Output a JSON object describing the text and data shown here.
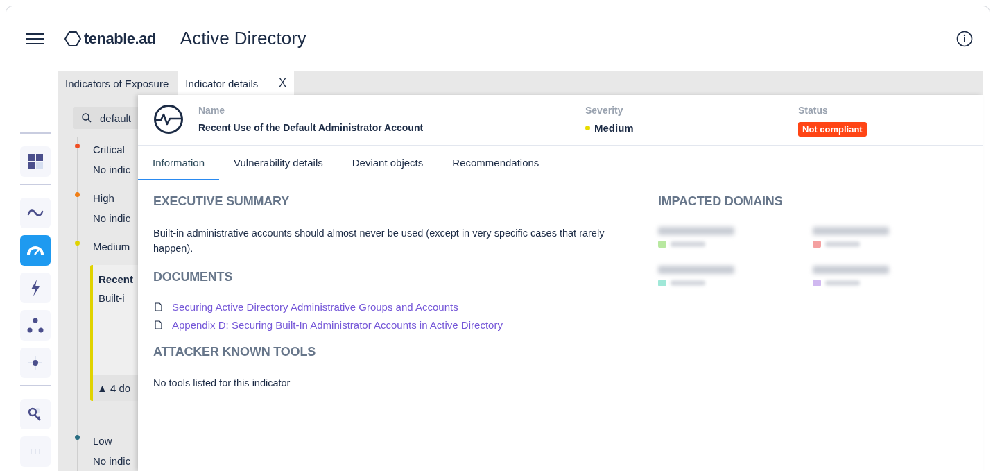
{
  "header": {
    "logo": "tenable.ad",
    "title": "Active Directory"
  },
  "rail": [
    {
      "kind": "divider"
    },
    {
      "kind": "dashboard",
      "selected": false
    },
    {
      "kind": "divider"
    },
    {
      "kind": "wave",
      "selected": false
    },
    {
      "kind": "gauge",
      "selected": true
    },
    {
      "kind": "bolt",
      "selected": false
    },
    {
      "kind": "nodes",
      "selected": false
    },
    {
      "kind": "target",
      "selected": false
    },
    {
      "kind": "divider"
    },
    {
      "kind": "key",
      "selected": false
    },
    {
      "kind": "faint",
      "selected": false
    }
  ],
  "tabs": [
    {
      "label": "Indicators of Exposure",
      "selected": false
    },
    {
      "label": "Indicator details",
      "selected": true,
      "close": "X"
    }
  ],
  "list": {
    "search": "default",
    "groups": [
      {
        "label": "Critical",
        "color": "#f04e23",
        "text": "No indic"
      },
      {
        "label": "High",
        "color": "#f07f16",
        "text": "No indic"
      },
      {
        "label": "Medium",
        "color": "#e0d300",
        "card": {
          "title": "Recent",
          "text": "Built-i",
          "footer": "▲ 4 do"
        }
      },
      {
        "label": "Low",
        "color": "#2b6e82",
        "text": "No indic"
      }
    ]
  },
  "detail": {
    "name_label": "Name",
    "name": "Recent Use of the Default Administrator Account",
    "severity_label": "Severity",
    "severity": {
      "text": "Medium",
      "color": "#e8dc00"
    },
    "status_label": "Status",
    "status": "Not compliant",
    "tabs": [
      {
        "label": "Information",
        "selected": true
      },
      {
        "label": "Vulnerability details",
        "selected": false
      },
      {
        "label": "Deviant objects",
        "selected": false
      },
      {
        "label": "Recommendations",
        "selected": false
      }
    ],
    "summary_heading": "EXECUTIVE SUMMARY",
    "summary": "Built-in administrative accounts should almost never be used (except in very specific cases that rarely happen).",
    "documents_heading": "DOCUMENTS",
    "documents": [
      "Securing Active Directory Administrative Groups and Accounts",
      "Appendix D: Securing Built-In Administrator Accounts in Active Directory"
    ],
    "tools_heading": "ATTACKER KNOWN TOOLS",
    "tools": "No tools listed for this indicator",
    "domains_heading": "IMPACTED DOMAINS",
    "domains": [
      {
        "color": "#b8e8a0"
      },
      {
        "color": "#f4a0a0"
      },
      {
        "color": "#a0e8d8"
      },
      {
        "color": "#d0b8f0"
      }
    ]
  }
}
